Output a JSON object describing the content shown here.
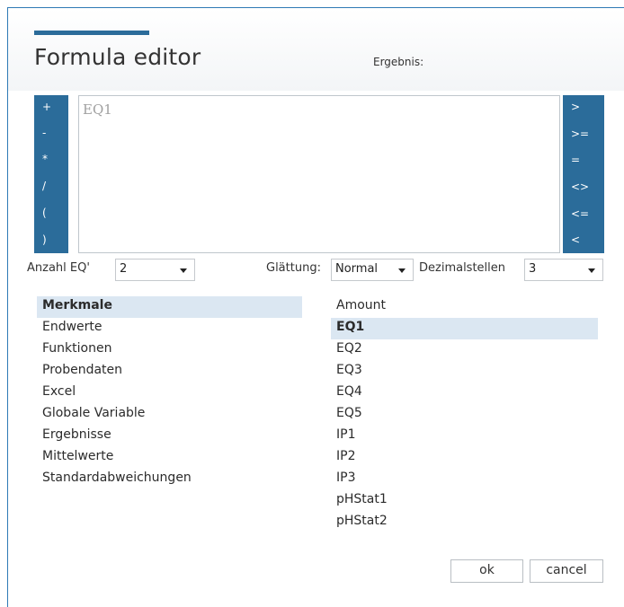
{
  "dialog": {
    "title": "Formula editor",
    "result_label": "Ergebnis:"
  },
  "operators_left": [
    "+",
    "-",
    "*",
    "/",
    "(",
    ")"
  ],
  "operators_right": [
    ">",
    ">=",
    "=",
    "<>",
    "<=",
    "<"
  ],
  "editor": {
    "value": "EQ1"
  },
  "controls": {
    "count_label": "Anzahl EQ'",
    "count_value": "2",
    "smoothing_label": "Glättung:",
    "smoothing_value": "Normal",
    "decimals_label": "Dezimalstellen",
    "decimals_value": "3"
  },
  "categories": [
    {
      "label": "Merkmale",
      "selected": true
    },
    {
      "label": "Endwerte"
    },
    {
      "label": "Funktionen"
    },
    {
      "label": "Probendaten"
    },
    {
      "label": "Excel"
    },
    {
      "label": "Globale Variable"
    },
    {
      "label": "Ergebnisse"
    },
    {
      "label": "Mittelwerte"
    },
    {
      "label": "Standardabweichungen"
    }
  ],
  "items": [
    {
      "label": "Amount"
    },
    {
      "label": "EQ1",
      "selected": true
    },
    {
      "label": "EQ2"
    },
    {
      "label": "EQ3"
    },
    {
      "label": "EQ4"
    },
    {
      "label": "EQ5"
    },
    {
      "label": "IP1"
    },
    {
      "label": "IP2"
    },
    {
      "label": "IP3"
    },
    {
      "label": "pHStat1"
    },
    {
      "label": "pHStat2"
    }
  ],
  "buttons": {
    "ok": "ok",
    "cancel": "cancel"
  },
  "colors": {
    "accent": "#2b6c9a",
    "selection": "#dbe7f2",
    "border": "#2e7ab5"
  }
}
